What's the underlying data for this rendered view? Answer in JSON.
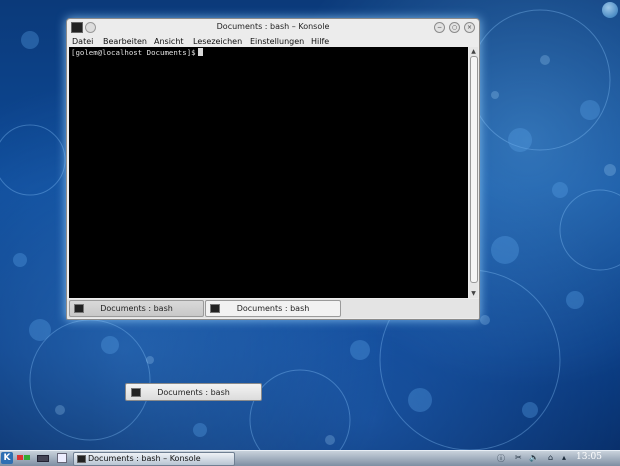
{
  "window": {
    "title": "Documents : bash – Konsole",
    "buttons": {
      "minimize": "−",
      "maximize": "○",
      "close": "×"
    }
  },
  "menu": [
    "Datei",
    "Bearbeiten",
    "Ansicht",
    "Lesezeichen",
    "Einstellungen",
    "Hilfe"
  ],
  "terminal": {
    "prompt": "[golem@localhost Documents]$"
  },
  "tabs": [
    {
      "label": "Documents : bash",
      "active": false
    },
    {
      "label": "Documents : bash",
      "active": true
    }
  ],
  "floating_preview": {
    "label": "Documents : bash"
  },
  "taskbar": {
    "kmenu_glyph": "K",
    "task_label": "Documents : bash – Konsole",
    "clock": "13:05"
  },
  "icons": {
    "window": "terminal-icon",
    "pin": "pin-icon",
    "kmenu": "kde-kmenu-icon",
    "tray": [
      "info-icon",
      "scissors-icon",
      "volume-icon",
      "network-icon",
      "arrow-up-icon"
    ]
  },
  "colors": {
    "terminal_bg": "#000000",
    "desktop_blue": "#0d4a98",
    "panel": "#9aa8b8"
  }
}
